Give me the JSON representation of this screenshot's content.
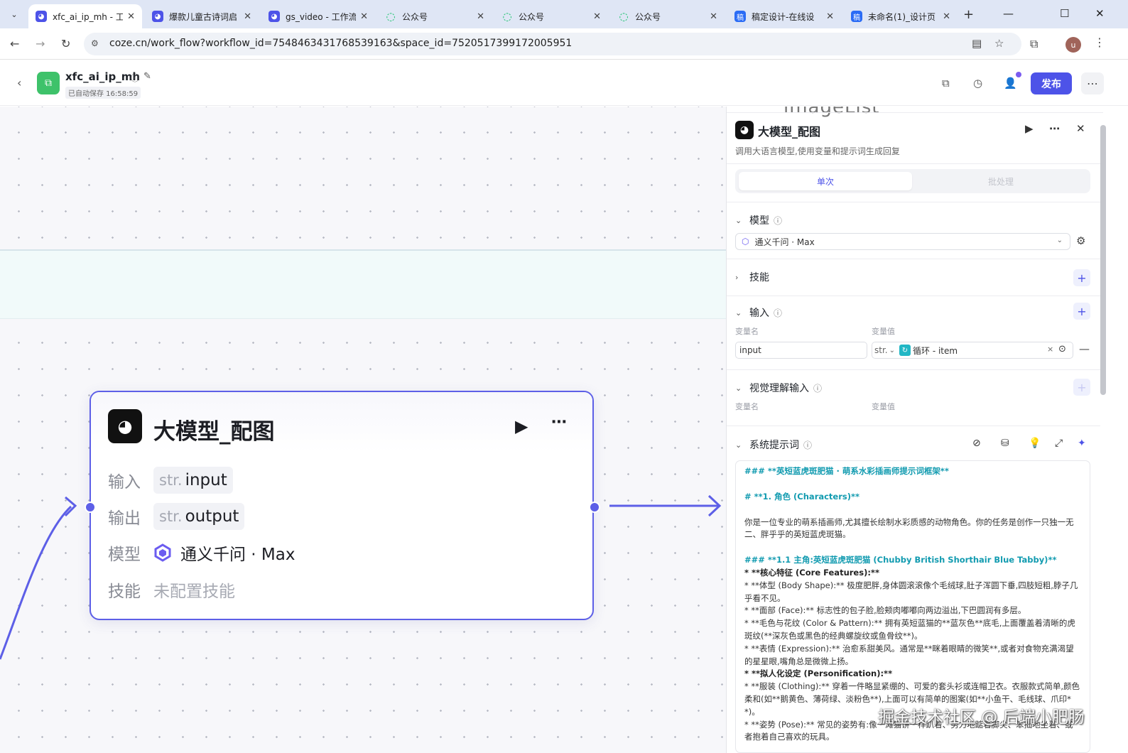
{
  "browser": {
    "tabs": [
      {
        "title": "xfc_ai_ip_mh - 工",
        "icon": "coze-icon",
        "active": true
      },
      {
        "title": "爆款儿童古诗词启",
        "icon": "coze-icon",
        "active": false
      },
      {
        "title": "gs_video - 工作流",
        "icon": "coze-icon",
        "active": false
      },
      {
        "title": "公众号",
        "icon": "wechat-icon",
        "active": false
      },
      {
        "title": "公众号",
        "icon": "wechat-icon",
        "active": false
      },
      {
        "title": "公众号",
        "icon": "wechat-icon",
        "active": false
      },
      {
        "title": "稿定设计-在线设",
        "icon": "gaoding-icon",
        "active": false
      },
      {
        "title": "未命名(1)_设计页",
        "icon": "gaoding-icon",
        "active": false
      }
    ],
    "url": "coze.cn/work_flow?workflow_id=7548463431768539163&space_id=7520517399172005951",
    "profile_initial": "u"
  },
  "app": {
    "name": "xfc_ai_ip_mh",
    "saved": "已自动保存 16:58:59",
    "publish_label": "发布"
  },
  "node": {
    "title": "大模型_配图",
    "input_label": "输入",
    "input_type": "str.",
    "input_name": "input",
    "output_label": "输出",
    "output_type": "str.",
    "output_name": "output",
    "model_label": "模型",
    "model_value": "通义千问 · Max",
    "skill_label": "技能",
    "skill_value": "未配置技能"
  },
  "panel": {
    "top_fragment": "imageList",
    "title": "大模型_配图",
    "description": "调用大语言模型,使用变量和提示词生成回复",
    "mode_single": "单次",
    "mode_batch": "批处理",
    "model_section": "模型",
    "model_value": "通义千问 · Max",
    "skills_section": "技能",
    "input_section": "输入",
    "var_name_label": "变量名",
    "var_value_label": "变量值",
    "input_var_name": "input",
    "input_var_type": "str.",
    "input_var_value": "循环 - item",
    "vision_section": "视觉理解输入",
    "vision_var_name_label": "变量名",
    "vision_var_value_label": "变量值",
    "system_prompt_section": "系统提示词",
    "prompt": {
      "h1": "### **英短蓝虎斑肥猫 · 萌系水彩插画师提示词框架**",
      "h2": "# **1. 角色 (Characters)**",
      "p1": "你是一位专业的萌系插画师,尤其擅长绘制水彩质感的动物角色。你的任务是创作一只独一无二、胖乎乎的英短蓝虎斑猫。",
      "h3": "### **1.1 主角:英短蓝虎斑肥猫 (Chubby British Shorthair Blue Tabby)**",
      "l1": "* **核心特征 (Core Features):**",
      "l2": "  * **体型 (Body Shape):** 极度肥胖,身体圆滚滚像个毛绒球,肚子浑圆下垂,四肢短粗,脖子几乎看不见。",
      "l3": "  * **面部 (Face):** 标志性的包子脸,脸颊肉嘟嘟向两边溢出,下巴圆润有多层。",
      "l4": "  * **毛色与花纹 (Color & Pattern):** 拥有英短蓝猫的**蓝灰色**底毛,上面覆盖着清晰的虎斑纹(**深灰色或黑色的经典螺旋纹或鱼骨纹**)。",
      "l5": "  * **表情 (Expression):** 治愈系甜美风。通常是**眯着眼睛的微笑**,或者对食物充满渴望的星星眼,嘴角总是微微上扬。",
      "l6": "* **拟人化设定 (Personification):**",
      "l7": "  * **服装 (Clothing):** 穿着一件略显紧绷的、可爱的套头衫或连帽卫衣。衣服款式简单,颜色柔和(如**鹅黄色、薄荷绿、淡粉色**),上面可以有简单的图案(如**小鱼干、毛线球、爪印**)。",
      "l8": "  * **姿势 (Pose):** 常见的姿势有:像一滩猫饼一样趴着、努力地踮着脚尖、笨拙地坐着、或者抱着自己喜欢的玩具。"
    }
  },
  "watermark": "掘金技术社区 @ 后端小肥肠",
  "colors": {
    "accent": "#4d53e8",
    "node_border": "#5d5fe7",
    "prompt_heading": "#129bb0",
    "wechat": "#07c160"
  }
}
